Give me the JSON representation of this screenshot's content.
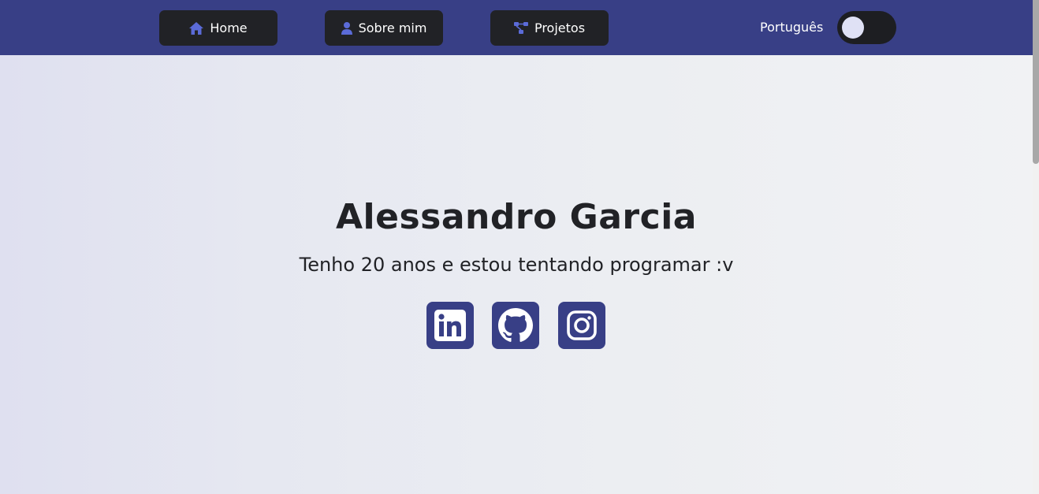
{
  "nav": {
    "home": "Home",
    "about": "Sobre mim",
    "projects": "Projetos",
    "language": "Português"
  },
  "hero": {
    "name": "Alessandro Garcia",
    "tagline": "Tenho 20 anos e estou tentando programar :v"
  },
  "social": [
    "linkedin-icon",
    "github-icon",
    "instagram-icon"
  ],
  "colors": {
    "navbar": "#383f86",
    "button": "#212226",
    "icon_accent": "#5b6bd8",
    "text": "#212226"
  }
}
